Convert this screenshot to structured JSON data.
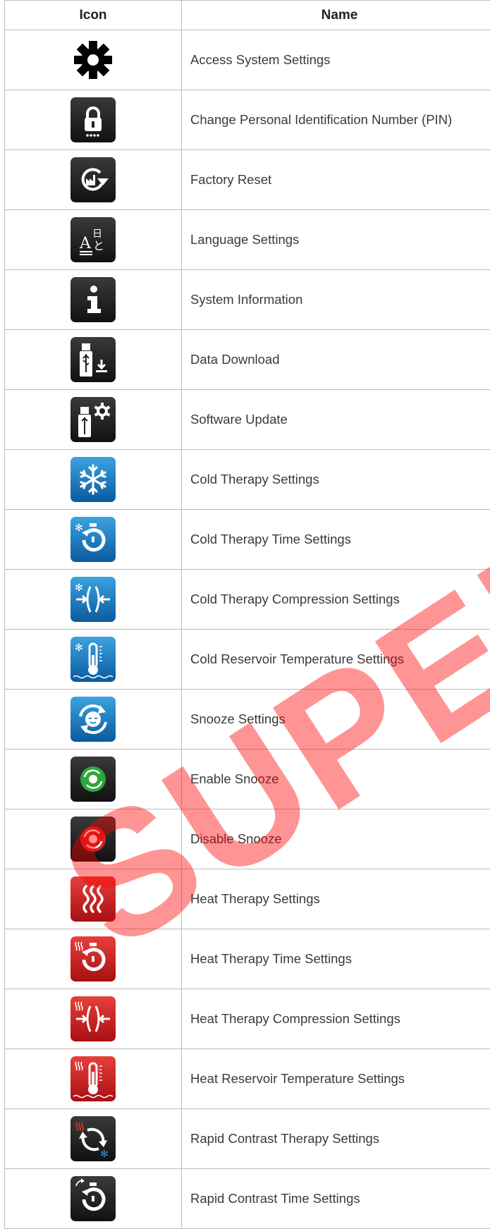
{
  "header": {
    "icon": "Icon",
    "name": "Name"
  },
  "watermark": "SUPER",
  "colors": {
    "dark": "#1e1e1e",
    "cold": "#1b84c8",
    "heat": "#d41c1c"
  },
  "rows": [
    {
      "name": "Access System Settings",
      "icon": "gear-icon"
    },
    {
      "name": "Change Personal Identification Number (PIN)",
      "icon": "lock-pin-icon"
    },
    {
      "name": "Factory Reset",
      "icon": "factory-reset-icon"
    },
    {
      "name": "Language Settings",
      "icon": "language-icon"
    },
    {
      "name": "System Information",
      "icon": "info-icon"
    },
    {
      "name": "Data Download",
      "icon": "usb-download-icon"
    },
    {
      "name": "Software Update",
      "icon": "usb-update-icon"
    },
    {
      "name": "Cold Therapy Settings",
      "icon": "snowflake-icon"
    },
    {
      "name": "Cold Therapy Time Settings",
      "icon": "cold-timer-icon"
    },
    {
      "name": "Cold Therapy Compression Settings",
      "icon": "cold-compression-icon"
    },
    {
      "name": "Cold Reservoir Temperature Settings",
      "icon": "cold-thermometer-icon"
    },
    {
      "name": "Snooze Settings",
      "icon": "snooze-icon"
    },
    {
      "name": "Enable Snooze",
      "icon": "enable-snooze-icon"
    },
    {
      "name": "Disable Snooze",
      "icon": "disable-snooze-icon"
    },
    {
      "name": "Heat Therapy Settings",
      "icon": "heat-waves-icon"
    },
    {
      "name": "Heat Therapy Time Settings",
      "icon": "heat-timer-icon"
    },
    {
      "name": "Heat Therapy Compression Settings",
      "icon": "heat-compression-icon"
    },
    {
      "name": "Heat Reservoir Temperature Settings",
      "icon": "heat-thermometer-icon"
    },
    {
      "name": "Rapid Contrast Therapy Settings",
      "icon": "contrast-therapy-icon"
    },
    {
      "name": "Rapid Contrast Time Settings",
      "icon": "contrast-timer-icon"
    }
  ]
}
